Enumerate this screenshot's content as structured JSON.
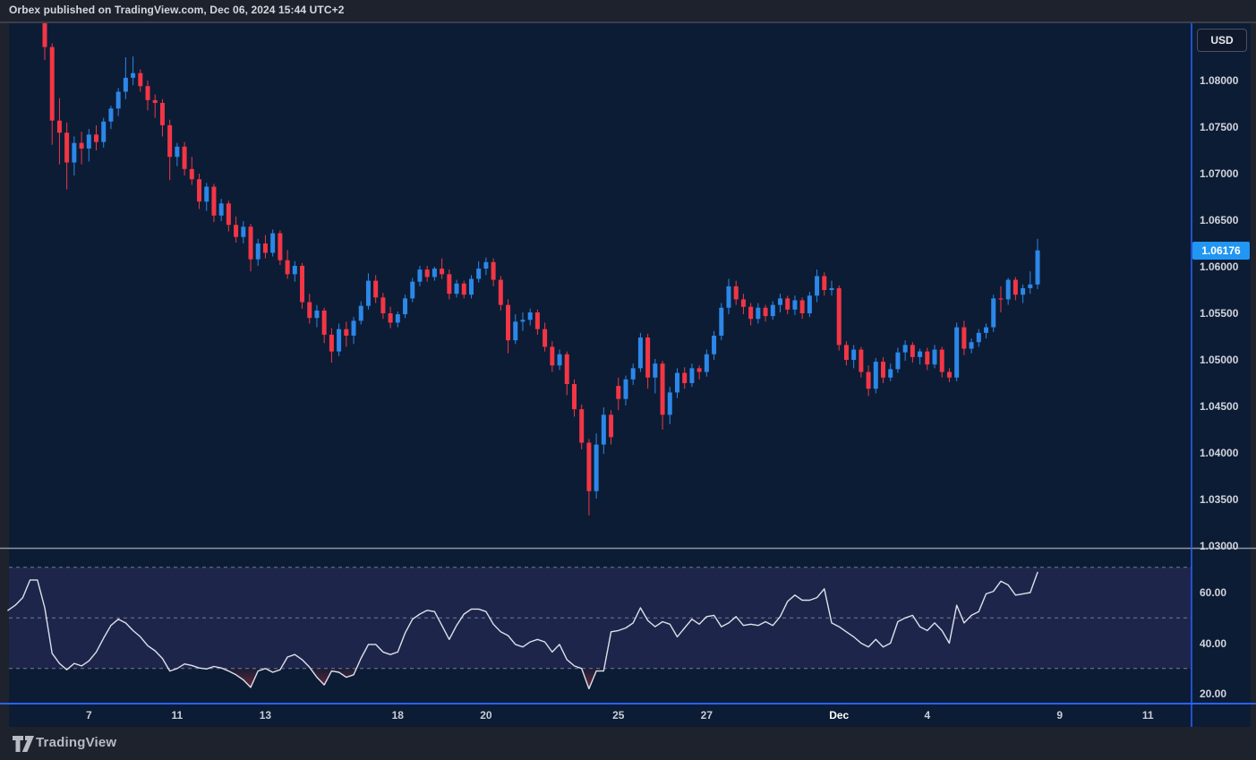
{
  "header": {
    "title": "Orbex published on TradingView.com, Dec 06, 2024 15:44 UTC+2"
  },
  "footer": {
    "brand": "TradingView"
  },
  "currency_button": {
    "label": "USD"
  },
  "colors": {
    "up_candle": "#2c87e8",
    "down_candle": "#f23645",
    "rsi_line": "#dde1ea",
    "rsi_band_fill": "rgba(126,87,194,0.16)",
    "oversold_fill": "#f23645",
    "level_dash": "#767b8c",
    "pane_border_blue": "#2962ff",
    "pane_separator": "#9094a0",
    "last_price_bg": "#2196f3",
    "pane_background": "#0c1c35"
  },
  "chart_data": [
    {
      "type": "candlestick",
      "pane": "price",
      "quote_currency": "USD",
      "timeframe": "4h bars (dates Nov 6 - Dec 6, 2024)",
      "last_price": 1.06176,
      "last_price_label": "1.06176",
      "ylim": [
        1.0297,
        1.0862
      ],
      "grid": "off",
      "y_ticks": [
        {
          "label": "1.08000",
          "value": 1.08
        },
        {
          "label": "1.07500",
          "value": 1.075
        },
        {
          "label": "1.07000",
          "value": 1.07
        },
        {
          "label": "1.06500",
          "value": 1.065
        },
        {
          "label": "1.06000",
          "value": 1.06
        },
        {
          "label": "1.05500",
          "value": 1.055
        },
        {
          "label": "1.05000",
          "value": 1.05
        },
        {
          "label": "1.04500",
          "value": 1.045
        },
        {
          "label": "1.04000",
          "value": 1.04
        },
        {
          "label": "1.03500",
          "value": 1.035
        },
        {
          "label": "1.03000",
          "value": 1.03
        }
      ],
      "x_ticks": [
        {
          "label": "7",
          "bar": 6
        },
        {
          "label": "11",
          "bar": 18
        },
        {
          "label": "13",
          "bar": 30
        },
        {
          "label": "18",
          "bar": 48
        },
        {
          "label": "20",
          "bar": 60
        },
        {
          "label": "25",
          "bar": 78
        },
        {
          "label": "27",
          "bar": 90
        },
        {
          "label": "Dec",
          "bar": 108,
          "emphasis": true
        },
        {
          "label": "4",
          "bar": 120
        },
        {
          "label": "9",
          "bar": 138
        },
        {
          "label": "11",
          "bar": 150
        }
      ],
      "ohlc": [
        [
          1.087,
          1.0875,
          1.0822,
          1.0836
        ],
        [
          1.0836,
          1.084,
          1.0731,
          1.0757
        ],
        [
          1.0757,
          1.0781,
          1.071,
          1.0744
        ],
        [
          1.0744,
          1.0755,
          1.0683,
          1.0712
        ],
        [
          1.0712,
          1.074,
          1.0698,
          1.0733
        ],
        [
          1.0733,
          1.0745,
          1.071,
          1.0727
        ],
        [
          1.0727,
          1.0748,
          1.0713,
          1.0742
        ],
        [
          1.0742,
          1.0752,
          1.0725,
          1.0734
        ],
        [
          1.0734,
          1.076,
          1.0728,
          1.0756
        ],
        [
          1.0756,
          1.0773,
          1.0748,
          1.077
        ],
        [
          1.077,
          1.0792,
          1.0762,
          1.0788
        ],
        [
          1.0788,
          1.0825,
          1.078,
          1.0803
        ],
        [
          1.0803,
          1.0826,
          1.0795,
          1.0808
        ],
        [
          1.0808,
          1.0812,
          1.0788,
          1.0794
        ],
        [
          1.0794,
          1.08,
          1.0768,
          1.0779
        ],
        [
          1.0779,
          1.0785,
          1.076,
          1.0776
        ],
        [
          1.0776,
          1.078,
          1.074,
          1.0752
        ],
        [
          1.0752,
          1.0758,
          1.0693,
          1.0718
        ],
        [
          1.0718,
          1.0733,
          1.0708,
          1.0729
        ],
        [
          1.0729,
          1.0734,
          1.0698,
          1.0705
        ],
        [
          1.0705,
          1.0718,
          1.0688,
          1.0694
        ],
        [
          1.0694,
          1.07,
          1.0662,
          1.067
        ],
        [
          1.067,
          1.069,
          1.066,
          1.0686
        ],
        [
          1.0686,
          1.0689,
          1.0648,
          1.0655
        ],
        [
          1.0655,
          1.0673,
          1.0649,
          1.0668
        ],
        [
          1.0668,
          1.0671,
          1.0638,
          1.0645
        ],
        [
          1.0645,
          1.0654,
          1.0626,
          1.0632
        ],
        [
          1.0632,
          1.0649,
          1.0625,
          1.0643
        ],
        [
          1.0643,
          1.0646,
          1.0595,
          1.0608
        ],
        [
          1.0608,
          1.063,
          1.0601,
          1.0625
        ],
        [
          1.0625,
          1.0634,
          1.0609,
          1.0615
        ],
        [
          1.0615,
          1.064,
          1.0611,
          1.0636
        ],
        [
          1.0636,
          1.0639,
          1.0602,
          1.0607
        ],
        [
          1.0607,
          1.0618,
          1.0587,
          1.0592
        ],
        [
          1.0592,
          1.0606,
          1.0584,
          1.0601
        ],
        [
          1.0601,
          1.0604,
          1.0555,
          1.0562
        ],
        [
          1.0562,
          1.0571,
          1.0539,
          1.0545
        ],
        [
          1.0545,
          1.0559,
          1.0535,
          1.0553
        ],
        [
          1.0553,
          1.0556,
          1.0518,
          1.0527
        ],
        [
          1.0527,
          1.0534,
          1.0497,
          1.0509
        ],
        [
          1.0509,
          1.0539,
          1.0504,
          1.0533
        ],
        [
          1.0533,
          1.0541,
          1.0514,
          1.0526
        ],
        [
          1.0526,
          1.0546,
          1.0517,
          1.0542
        ],
        [
          1.0542,
          1.0563,
          1.0538,
          1.0558
        ],
        [
          1.0558,
          1.0593,
          1.0554,
          1.0585
        ],
        [
          1.0585,
          1.0591,
          1.0561,
          1.0567
        ],
        [
          1.0567,
          1.0572,
          1.0544,
          1.055
        ],
        [
          1.055,
          1.0557,
          1.0534,
          1.054
        ],
        [
          1.054,
          1.0552,
          1.0535,
          1.0549
        ],
        [
          1.0549,
          1.057,
          1.0545,
          1.0566
        ],
        [
          1.0566,
          1.0588,
          1.0562,
          1.0584
        ],
        [
          1.0584,
          1.0601,
          1.0579,
          1.0597
        ],
        [
          1.0597,
          1.0601,
          1.0584,
          1.0589
        ],
        [
          1.0589,
          1.06,
          1.0585,
          1.0598
        ],
        [
          1.0598,
          1.0609,
          1.0587,
          1.0592
        ],
        [
          1.0592,
          1.0597,
          1.0565,
          1.0571
        ],
        [
          1.0571,
          1.0586,
          1.0567,
          1.0582
        ],
        [
          1.0582,
          1.0585,
          1.0566,
          1.057
        ],
        [
          1.057,
          1.0591,
          1.0566,
          1.0587
        ],
        [
          1.0587,
          1.0606,
          1.0583,
          1.0598
        ],
        [
          1.0598,
          1.061,
          1.0591,
          1.0605
        ],
        [
          1.0605,
          1.0609,
          1.0579,
          1.0586
        ],
        [
          1.0586,
          1.059,
          1.0553,
          1.0559
        ],
        [
          1.0559,
          1.0565,
          1.0507,
          1.0521
        ],
        [
          1.0521,
          1.0549,
          1.0517,
          1.0541
        ],
        [
          1.0541,
          1.0551,
          1.0531,
          1.0543
        ],
        [
          1.0543,
          1.0555,
          1.0537,
          1.0551
        ],
        [
          1.0551,
          1.0554,
          1.0527,
          1.0533
        ],
        [
          1.0533,
          1.054,
          1.0509,
          1.0514
        ],
        [
          1.0514,
          1.052,
          1.0487,
          1.0494
        ],
        [
          1.0494,
          1.0511,
          1.0489,
          1.0506
        ],
        [
          1.0506,
          1.0509,
          1.0462,
          1.0474
        ],
        [
          1.0474,
          1.0479,
          1.0439,
          1.0447
        ],
        [
          1.0447,
          1.0452,
          1.0404,
          1.0411
        ],
        [
          1.0411,
          1.0415,
          1.0333,
          1.0359
        ],
        [
          1.0359,
          1.0421,
          1.0351,
          1.0409
        ],
        [
          1.0409,
          1.0449,
          1.0399,
          1.0441
        ],
        [
          1.0441,
          1.0446,
          1.0409,
          1.0417
        ],
        [
          1.0472,
          1.0481,
          1.0446,
          1.0458
        ],
        [
          1.0458,
          1.0483,
          1.0451,
          1.0479
        ],
        [
          1.0479,
          1.0496,
          1.0473,
          1.0491
        ],
        [
          1.0491,
          1.0529,
          1.0487,
          1.0524
        ],
        [
          1.0524,
          1.0528,
          1.0469,
          1.0481
        ],
        [
          1.0481,
          1.0501,
          1.0464,
          1.0496
        ],
        [
          1.0496,
          1.0499,
          1.0425,
          1.0441
        ],
        [
          1.0441,
          1.0471,
          1.0431,
          1.0465
        ],
        [
          1.0465,
          1.0491,
          1.0459,
          1.0486
        ],
        [
          1.0486,
          1.0492,
          1.0469,
          1.0475
        ],
        [
          1.0475,
          1.0496,
          1.0471,
          1.0491
        ],
        [
          1.0491,
          1.0494,
          1.0479,
          1.0487
        ],
        [
          1.0487,
          1.0511,
          1.0482,
          1.0506
        ],
        [
          1.0506,
          1.0531,
          1.05,
          1.0526
        ],
        [
          1.0526,
          1.0561,
          1.0521,
          1.0556
        ],
        [
          1.0556,
          1.0587,
          1.0549,
          1.0579
        ],
        [
          1.0579,
          1.0585,
          1.0559,
          1.0565
        ],
        [
          1.0565,
          1.0571,
          1.0549,
          1.0557
        ],
        [
          1.0557,
          1.0561,
          1.0537,
          1.0544
        ],
        [
          1.0544,
          1.0561,
          1.0539,
          1.0556
        ],
        [
          1.0556,
          1.0559,
          1.0541,
          1.0547
        ],
        [
          1.0547,
          1.0563,
          1.0543,
          1.0559
        ],
        [
          1.0559,
          1.0571,
          1.0551,
          1.0566
        ],
        [
          1.0566,
          1.0569,
          1.0549,
          1.0554
        ],
        [
          1.0554,
          1.0569,
          1.0548,
          1.0564
        ],
        [
          1.0564,
          1.0567,
          1.0544,
          1.055
        ],
        [
          1.055,
          1.0573,
          1.0546,
          1.0569
        ],
        [
          1.0569,
          1.0597,
          1.0562,
          1.059
        ],
        [
          1.059,
          1.0594,
          1.0569,
          1.0575
        ],
        [
          1.0575,
          1.0585,
          1.0569,
          1.0577
        ],
        [
          1.0577,
          1.058,
          1.051,
          1.0516
        ],
        [
          1.0516,
          1.052,
          1.0494,
          1.05
        ],
        [
          1.05,
          1.0516,
          1.0491,
          1.0511
        ],
        [
          1.0511,
          1.0514,
          1.0481,
          1.0487
        ],
        [
          1.0487,
          1.0494,
          1.0461,
          1.0469
        ],
        [
          1.0469,
          1.0502,
          1.0464,
          1.0498
        ],
        [
          1.0498,
          1.0503,
          1.0475,
          1.0481
        ],
        [
          1.0481,
          1.0496,
          1.0477,
          1.049
        ],
        [
          1.049,
          1.0513,
          1.0486,
          1.0508
        ],
        [
          1.0508,
          1.0521,
          1.0499,
          1.0516
        ],
        [
          1.0516,
          1.0519,
          1.0497,
          1.0503
        ],
        [
          1.0503,
          1.0512,
          1.0495,
          1.0509
        ],
        [
          1.0509,
          1.0513,
          1.0489,
          1.0495
        ],
        [
          1.0495,
          1.0516,
          1.0491,
          1.0511
        ],
        [
          1.0511,
          1.0514,
          1.0481,
          1.0487
        ],
        [
          1.0487,
          1.0491,
          1.0476,
          1.0481
        ],
        [
          1.0481,
          1.054,
          1.0477,
          1.0535
        ],
        [
          1.0535,
          1.0542,
          1.0505,
          1.0512
        ],
        [
          1.0512,
          1.0523,
          1.0507,
          1.0519
        ],
        [
          1.0519,
          1.0533,
          1.0514,
          1.0529
        ],
        [
          1.0529,
          1.0539,
          1.0523,
          1.0535
        ],
        [
          1.0535,
          1.057,
          1.053,
          1.0566
        ],
        [
          1.0566,
          1.0579,
          1.0551,
          1.0565
        ],
        [
          1.0565,
          1.0588,
          1.0559,
          1.0586
        ],
        [
          1.0586,
          1.0589,
          1.0564,
          1.057
        ],
        [
          1.057,
          1.0581,
          1.0561,
          1.0577
        ],
        [
          1.0577,
          1.0595,
          1.0571,
          1.0581
        ],
        [
          1.0581,
          1.063,
          1.0576,
          1.06176
        ]
      ]
    },
    {
      "type": "line",
      "pane": "rsi",
      "name": "RSI",
      "grid": "off",
      "legend_position": "none",
      "ylim": [
        16,
        77.5
      ],
      "levels": {
        "overbought": 70,
        "middle": 50,
        "oversold": 30
      },
      "y_ticks": [
        {
          "label": "60.00",
          "value": 60
        },
        {
          "label": "40.00",
          "value": 40
        },
        {
          "label": "20.00",
          "value": 20
        }
      ],
      "first_bar_offset": -5,
      "values": [
        53,
        55,
        58,
        65,
        65,
        54,
        36,
        32,
        29.5,
        32,
        31,
        33,
        36.5,
        42,
        47,
        49.5,
        48,
        45,
        42.5,
        39,
        37,
        34,
        29,
        30,
        31.8,
        31.2,
        30.2,
        29.8,
        30.8,
        30.2,
        29,
        27.5,
        25.5,
        22.5,
        29,
        30,
        28.5,
        29.5,
        34.5,
        35.5,
        33.5,
        30.5,
        26.5,
        23.5,
        29,
        28.5,
        26.5,
        27.5,
        34,
        39.5,
        39.5,
        36.5,
        35.5,
        36.5,
        44,
        49.5,
        51.5,
        53,
        52.5,
        47,
        41.5,
        47,
        51.5,
        53.5,
        53.5,
        52.5,
        47.5,
        44.5,
        43,
        39.5,
        38.5,
        40.5,
        41.5,
        40.5,
        36.5,
        39.5,
        33.5,
        31,
        30,
        22,
        29,
        29,
        44.5,
        45,
        46,
        48,
        54,
        49,
        46.5,
        48.5,
        47.5,
        42.5,
        46,
        49.5,
        47.5,
        50.5,
        51,
        46.5,
        48,
        50.5,
        47,
        47.5,
        47,
        48.5,
        47,
        50.5,
        56.5,
        59,
        57,
        57,
        58,
        61.5,
        48,
        46.5,
        44.5,
        42.5,
        40,
        38.5,
        41.5,
        38.5,
        40,
        48.5,
        50,
        51,
        46.5,
        45,
        48,
        45,
        40,
        55,
        48,
        51,
        52.5,
        59.5,
        60.5,
        64.5,
        63,
        59,
        59.5,
        60,
        68
      ]
    }
  ]
}
